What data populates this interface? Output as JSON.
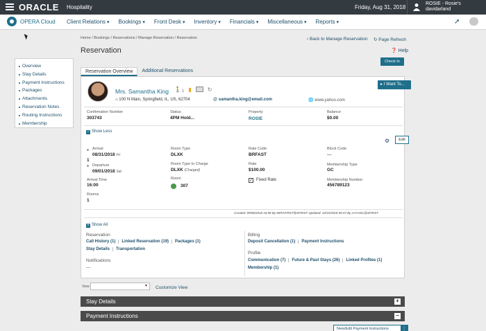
{
  "topbar": {
    "brand": "ORACLE",
    "product": "Hospitality",
    "date": "Friday, Aug 31, 2018",
    "user_line1": "ROSIE - Rosie's",
    "user_line2": "davidarland"
  },
  "nav": {
    "app_name": "OPERA Cloud",
    "menu": [
      "Client Relations",
      "Bookings",
      "Front Desk",
      "Inventory",
      "Financials",
      "Miscellaneous",
      "Reports"
    ]
  },
  "breadcrumb": "Home / Bookings / Reservations / Manage Reservation / Reservation",
  "back_link": "Back to Manage Reservation",
  "refresh_link": "Page Refresh",
  "page_title": "Reservation",
  "help": "Help",
  "check_in": "Check In",
  "sidebar": {
    "items": [
      {
        "label": "Overview"
      },
      {
        "label": "Stay Details"
      },
      {
        "label": "Payment Instructions"
      },
      {
        "label": "Packages"
      },
      {
        "label": "Attachments"
      },
      {
        "label": "Reservation Notes"
      },
      {
        "label": "Routing Instructions"
      },
      {
        "label": "Membership"
      }
    ]
  },
  "tabs": [
    {
      "label": "Reservation Overview",
      "active": true
    },
    {
      "label": "Additional Reservations",
      "active": false
    }
  ],
  "guest": {
    "name": "Mrs. Samantha King",
    "address": "100 N Main, Springfield, IL, US, 62704",
    "email": "samantha.king@email.com",
    "website": "www.yahoo.com",
    "icon_text": "1"
  },
  "i_want_to": "I Want To...",
  "summary": {
    "confirmation_label": "Confirmation Number",
    "confirmation": "303743",
    "status_label": "Status",
    "status": "4PM Hold...",
    "property_label": "Property",
    "property": "ROSIE",
    "balance_label": "Balance",
    "balance": "$0.00"
  },
  "show_less": "Show Less",
  "edit": "Edit",
  "details": {
    "arrival_label": "Arrival",
    "arrival": "08/31/2018",
    "arrival_day": "Fri",
    "nights": "1",
    "departure_label": "Departure",
    "departure": "09/01/2018",
    "departure_day": "Sat",
    "arrival_time_label": "Arrival Time",
    "arrival_time": "16:00",
    "rooms_label": "Rooms",
    "rooms": "1",
    "room_type_label": "Room Type",
    "room_type": "DLXK",
    "room_type_charge_label": "Room Type to Charge",
    "room_type_charge": "DLXK",
    "charged": "(Charged)",
    "room_label": "Room",
    "room": "307",
    "rate_code_label": "Rate Code",
    "rate_code": "BRFAST",
    "rate_label": "Rate",
    "rate": "$100.00",
    "fixed_rate": "Fixed Rate",
    "block_code_label": "Block Code",
    "block_code": "—",
    "membership_type_label": "Membership Type",
    "membership_type": "GC",
    "membership_number_label": "Membership Number",
    "membership_number": "456789123"
  },
  "created": "Created: 09/06/2018 16:58  By  MIRAFIRST@SFIRST     Updated: 10/15/2018 09:47  By  AAYANC@SFIRST",
  "show_all": "Show All",
  "reservation_section": {
    "label": "Reservation",
    "row1": [
      "Call History (1)",
      "Linked Reservation (19)",
      "Packages (1)"
    ],
    "row2": [
      "Stay Details",
      "Transportation"
    ]
  },
  "notifications": {
    "label": "Notifications",
    "value": "—"
  },
  "billing": {
    "label": "Billing",
    "links": [
      "Deposit Cancellation (1)",
      "Payment Instructions"
    ]
  },
  "profile": {
    "label": "Profile",
    "row1": [
      "Communication (7)",
      "Future & Past Stays (26)",
      "Linked Profiles (1)"
    ],
    "row2": [
      "Membership (1)"
    ]
  },
  "view": {
    "label": "View",
    "value": "",
    "customize": "Customize View"
  },
  "stay_details_bar": {
    "label": "Stay Details",
    "control": "+"
  },
  "payment_bar": {
    "label": "Payment Instructions",
    "control": "−"
  },
  "new_edit_payment": "New/Edit Payment Instructions"
}
